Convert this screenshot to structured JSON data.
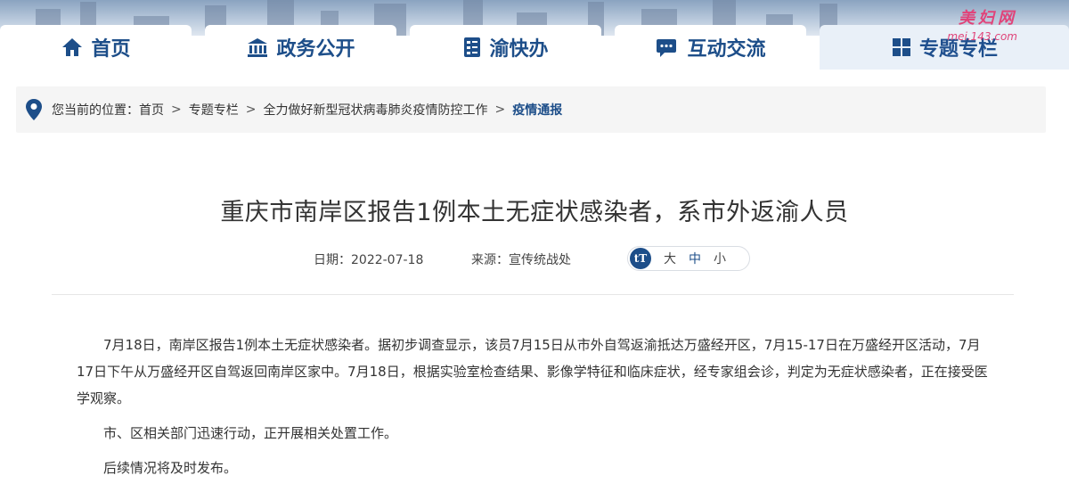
{
  "watermark": {
    "text": "美妇网",
    "url": "mei.143.com"
  },
  "nav": {
    "tabs": [
      {
        "label": "首页",
        "icon": "home-icon"
      },
      {
        "label": "政务公开",
        "icon": "government-building-icon"
      },
      {
        "label": "渝快办",
        "icon": "document-check-icon"
      },
      {
        "label": "互动交流",
        "icon": "chat-bubble-icon"
      },
      {
        "label": "专题专栏",
        "icon": "grid-icon",
        "active": true
      }
    ]
  },
  "breadcrumb": {
    "prefix": "您当前的位置：",
    "separator": ">",
    "items": [
      "首页",
      "专题专栏",
      "全力做好新型冠状病毒肺炎疫情防控工作",
      "疫情通报"
    ]
  },
  "article": {
    "title": "重庆市南岸区报告1例本土无症状感染者，系市外返渝人员",
    "date_label": "日期：2022-07-18",
    "source_label": "来源：宣传统战处",
    "font_size": {
      "icon": "tT",
      "large": "大",
      "medium": "中",
      "small": "小"
    },
    "paragraphs": [
      "7月18日，南岸区报告1例本土无症状感染者。据初步调查显示，该员7月15日从市外自驾返渝抵达万盛经开区，7月15-17日在万盛经开区活动，7月17日下午从万盛经开区自驾返回南岸区家中。7月18日，根据实验室检查结果、影像学特征和临床症状，经专家组会诊，判定为无症状感染者，正在接受医学观察。",
      "市、区相关部门迅速行动，正开展相关处置工作。",
      "后续情况将及时发布。"
    ]
  },
  "colors": {
    "brand": "#1d4e89",
    "accent": "#e0447a"
  }
}
